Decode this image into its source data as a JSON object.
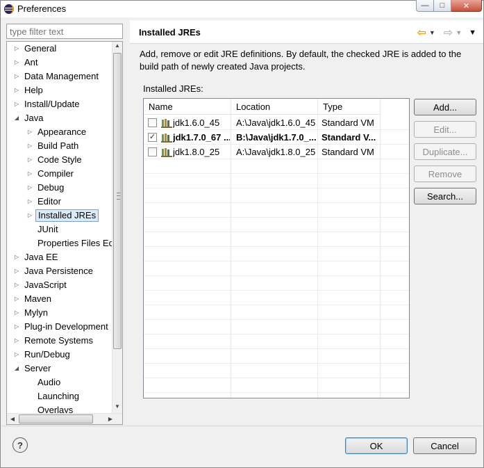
{
  "window": {
    "title": "Preferences",
    "controls": {
      "minimize": "—",
      "maximize": "□",
      "close": "✕"
    }
  },
  "filter": {
    "placeholder": "type filter text",
    "value": ""
  },
  "tree": {
    "items": [
      {
        "label": "General",
        "level": 0,
        "expanded": false
      },
      {
        "label": "Ant",
        "level": 0,
        "expanded": false
      },
      {
        "label": "Data Management",
        "level": 0,
        "expanded": false
      },
      {
        "label": "Help",
        "level": 0,
        "expanded": false
      },
      {
        "label": "Install/Update",
        "level": 0,
        "expanded": false
      },
      {
        "label": "Java",
        "level": 0,
        "expanded": true
      },
      {
        "label": "Appearance",
        "level": 1,
        "expanded": false
      },
      {
        "label": "Build Path",
        "level": 1,
        "expanded": false
      },
      {
        "label": "Code Style",
        "level": 1,
        "expanded": false
      },
      {
        "label": "Compiler",
        "level": 1,
        "expanded": false
      },
      {
        "label": "Debug",
        "level": 1,
        "expanded": false
      },
      {
        "label": "Editor",
        "level": 1,
        "expanded": false
      },
      {
        "label": "Installed JREs",
        "level": 1,
        "expanded": false,
        "selected": true
      },
      {
        "label": "JUnit",
        "level": 1,
        "leaf": true
      },
      {
        "label": "Properties Files Ed",
        "level": 1,
        "leaf": true
      },
      {
        "label": "Java EE",
        "level": 0,
        "expanded": false
      },
      {
        "label": "Java Persistence",
        "level": 0,
        "expanded": false
      },
      {
        "label": "JavaScript",
        "level": 0,
        "expanded": false
      },
      {
        "label": "Maven",
        "level": 0,
        "expanded": false
      },
      {
        "label": "Mylyn",
        "level": 0,
        "expanded": false
      },
      {
        "label": "Plug-in Development",
        "level": 0,
        "expanded": false
      },
      {
        "label": "Remote Systems",
        "level": 0,
        "expanded": false
      },
      {
        "label": "Run/Debug",
        "level": 0,
        "expanded": false
      },
      {
        "label": "Server",
        "level": 0,
        "expanded": true
      },
      {
        "label": "Audio",
        "level": 1,
        "leaf": true
      },
      {
        "label": "Launching",
        "level": 1,
        "leaf": true
      },
      {
        "label": "Overlays",
        "level": 1,
        "leaf": true
      }
    ]
  },
  "page": {
    "title": "Installed JREs",
    "description": "Add, remove or edit JRE definitions. By default, the checked JRE is added to the build path of newly created Java projects.",
    "table_label": "Installed JREs:",
    "columns": [
      "Name",
      "Location",
      "Type"
    ],
    "rows": [
      {
        "name": "jdk1.6.0_45",
        "location": "A:\\Java\\jdk1.6.0_45",
        "type": "Standard VM",
        "checked": false
      },
      {
        "name": "jdk1.7.0_67 ...",
        "location": "B:\\Java\\jdk1.7.0_...",
        "type": "Standard V...",
        "checked": true
      },
      {
        "name": "jdk1.8.0_25",
        "location": "A:\\Java\\jdk1.8.0_25",
        "type": "Standard VM",
        "checked": false
      }
    ],
    "buttons": [
      {
        "label": "Add...",
        "enabled": true
      },
      {
        "label": "Edit...",
        "enabled": false
      },
      {
        "label": "Duplicate...",
        "enabled": false
      },
      {
        "label": "Remove",
        "enabled": false
      },
      {
        "label": "Search...",
        "enabled": true
      }
    ]
  },
  "footer": {
    "help": "?",
    "ok": "OK",
    "cancel": "Cancel"
  },
  "colors": {
    "accent": "#3c7fb1",
    "selection": "#dbeaf9",
    "back_arrow": "#e1a419"
  }
}
